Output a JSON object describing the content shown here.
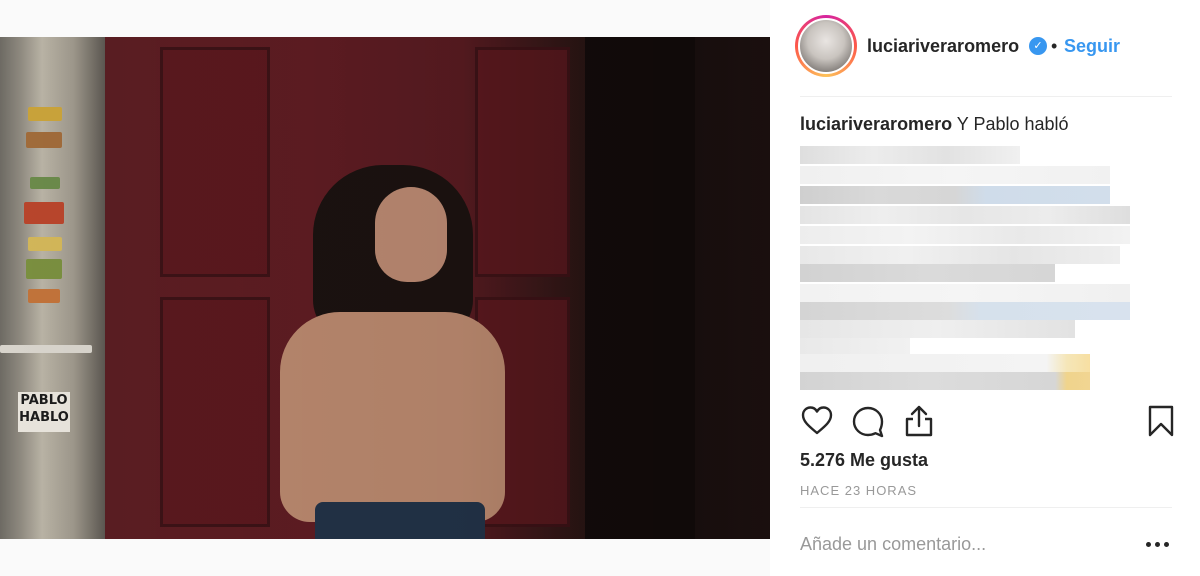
{
  "post": {
    "author": "luciariveraromero",
    "verified": true,
    "separator": "•",
    "follow_label": "Seguir",
    "caption_text": "Y Pablo habló",
    "likes": "5.276 Me gusta",
    "timestamp": "HACE 23 HORAS",
    "comment_placeholder": "Añade un comentario...",
    "photo_sign_text": "PABLO HABLO"
  },
  "icons": {
    "verified": "verified-badge-icon",
    "like": "heart-icon",
    "comment": "comment-bubble-icon",
    "share": "share-upload-icon",
    "save": "bookmark-icon",
    "more": "more-options-icon"
  },
  "colors": {
    "accent": "#3897f0",
    "text": "#262626",
    "muted": "#999999"
  }
}
